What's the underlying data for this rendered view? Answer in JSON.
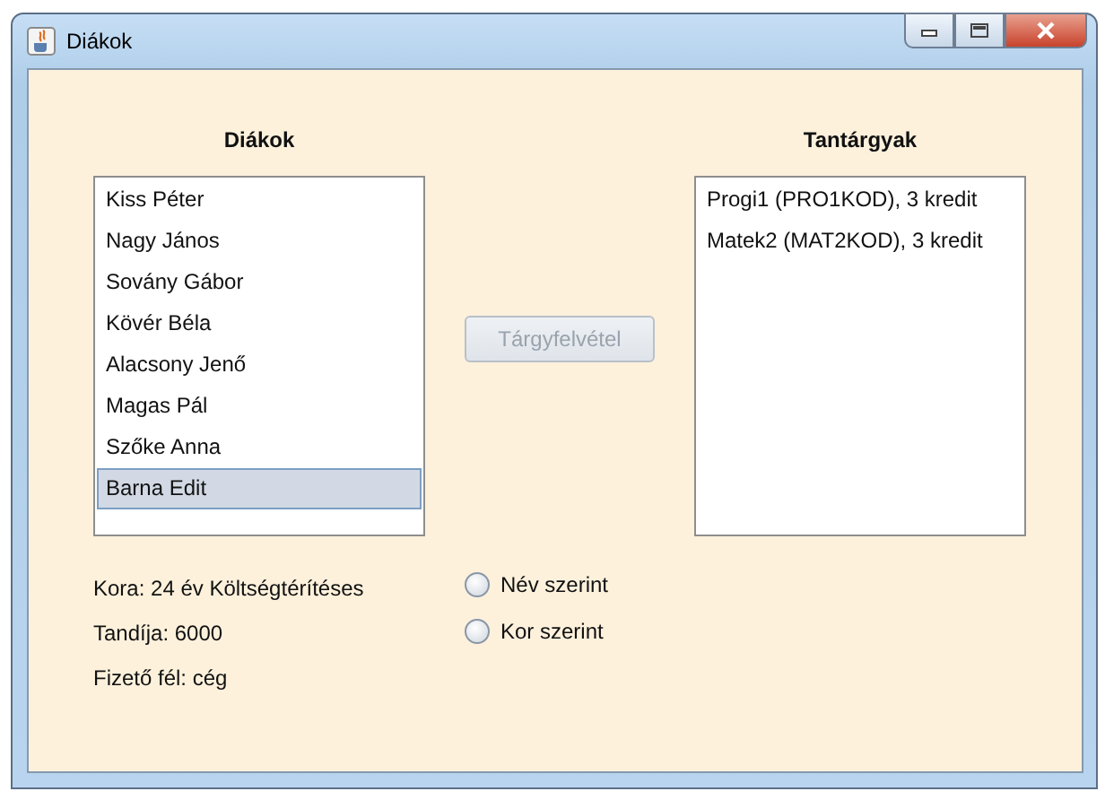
{
  "window": {
    "title": "Diákok"
  },
  "students": {
    "heading": "Diákok",
    "items": [
      {
        "label": "Kiss Péter",
        "selected": false
      },
      {
        "label": "Nagy János",
        "selected": false
      },
      {
        "label": "Sovány Gábor",
        "selected": false
      },
      {
        "label": "Kövér Béla",
        "selected": false
      },
      {
        "label": "Alacsony Jenő",
        "selected": false
      },
      {
        "label": "Magas Pál",
        "selected": false
      },
      {
        "label": "Szőke Anna",
        "selected": false
      },
      {
        "label": "Barna Edit",
        "selected": true
      }
    ]
  },
  "enroll_button": {
    "label": "Tárgyfelvétel",
    "disabled": true
  },
  "subjects": {
    "heading": "Tantárgyak",
    "items": [
      {
        "label": "Progi1 (PRO1KOD), 3 kredit",
        "selected": false
      },
      {
        "label": "Matek2 (MAT2KOD), 3 kredit",
        "selected": false
      }
    ]
  },
  "details": [
    "Kora: 24 év Költségtérítéses",
    "Tandíja: 6000",
    "Fizető fél: cég"
  ],
  "sort_options": [
    {
      "label": "Név szerint",
      "selected": false
    },
    {
      "label": "Kor szerint",
      "selected": false
    }
  ]
}
